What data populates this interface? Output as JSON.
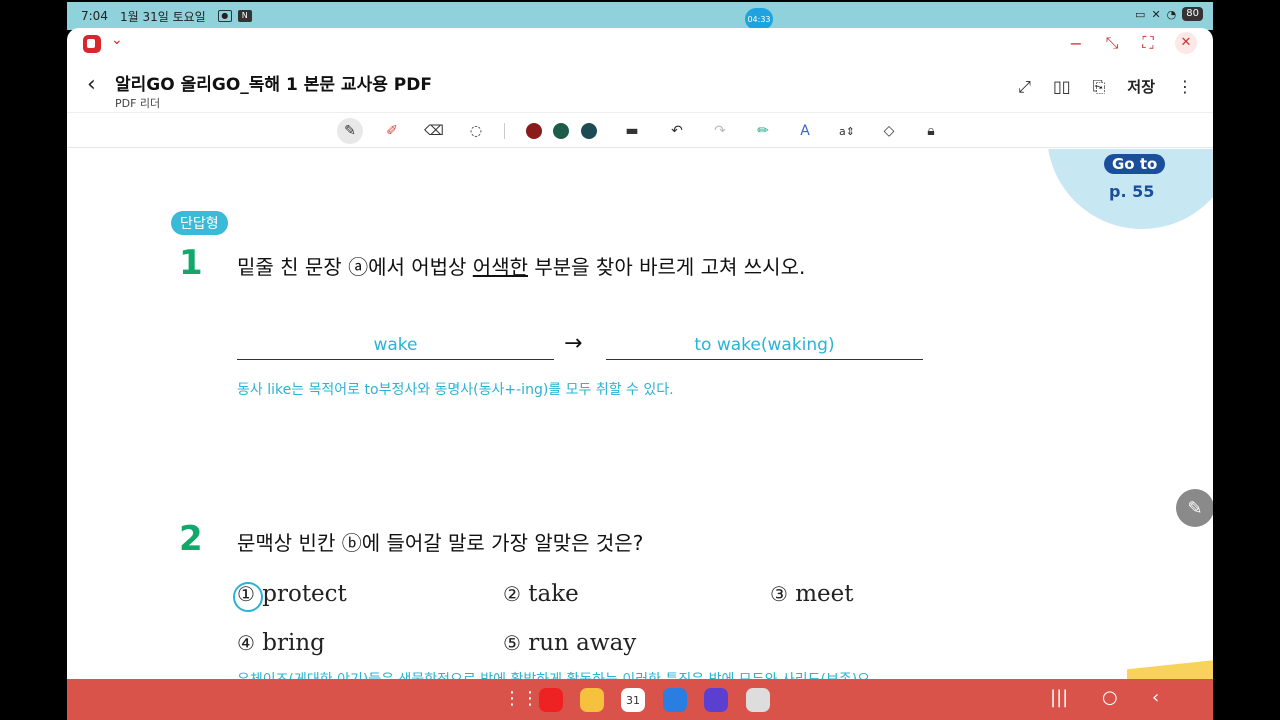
{
  "status": {
    "time": "7:04",
    "date": "1월 31일 토요일",
    "recording": "04:33",
    "battery": "80"
  },
  "header": {
    "title": "알리GO 올리GO_독해 1 본문  교사용 PDF",
    "subtitle": "PDF 리더",
    "save_label": "저장"
  },
  "toolbar": {
    "colors": [
      "#8b1a1a",
      "#1e5c4a",
      "#1c4a55"
    ]
  },
  "doc": {
    "goto_label": "Go to",
    "goto_page": "p. 55",
    "section_tag": "단답형",
    "q1": {
      "number": "1",
      "text_before": "밑줄 친 문장 ⓐ에서 어법상 ",
      "text_underlined": "어색한",
      "text_after": " 부분을 찾아 바르게 고쳐 쓰시오.",
      "answer_wrong": "wake",
      "arrow": "→",
      "answer_right": "to wake(waking)",
      "explanation": "동사 like는 목적어로 to부정사와 동명사(동사+-ing)를 모두 취할 수 있다."
    },
    "q2": {
      "number": "2",
      "text": "문맥상 빈칸 ⓑ에 들어갈 말로 가장 알맞은 것은?",
      "options": [
        {
          "num": "①",
          "label": "protect"
        },
        {
          "num": "②",
          "label": "take"
        },
        {
          "num": "③",
          "label": "meet"
        },
        {
          "num": "④",
          "label": "bring"
        },
        {
          "num": "⑤",
          "label": "run away"
        }
      ],
      "cut_text": "우체이즈(게대한 야기)들은 생물학적으로 밤에 활발하게 활동하는 이러한 특징은 밤에 모두와 사리도(보존)으"
    }
  }
}
